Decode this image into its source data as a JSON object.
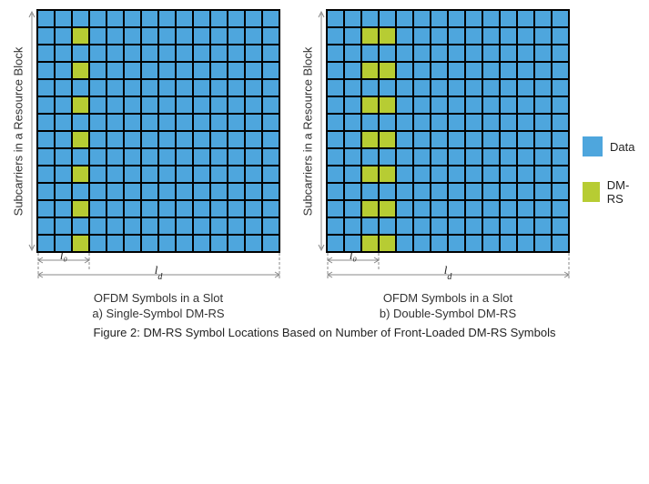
{
  "figure": {
    "caption": "Figure 2: DM-RS Symbol Locations Based on Number of Front-Loaded DM-RS Symbols",
    "yAxisLabel": "Subcarriers in a Resource Block",
    "xAxisLabel": "OFDM Symbols in a Slot",
    "l0Label": "l₀",
    "ldLabel": "l_d",
    "legend": {
      "data": "Data",
      "dmrs": "DM-RS"
    }
  },
  "colors": {
    "data": "#4ea6dd",
    "dmrs": "#b7cc33"
  },
  "panelA": {
    "subcaption": "a) Single-Symbol DM-RS"
  },
  "panelB": {
    "subcaption": "b) Double-Symbol DM-RS"
  },
  "chart_data": [
    {
      "type": "heatmap",
      "name": "Single-Symbol DM-RS",
      "rows": 14,
      "cols": 14,
      "cell_size_px": 19,
      "ylabel": "Subcarriers in a Resource Block",
      "xlabel": "OFDM Symbols in a Slot",
      "annotations": {
        "l0_cols": [
          0,
          1,
          2
        ],
        "ld_cols": [
          0,
          1,
          2,
          3,
          4,
          5,
          6,
          7,
          8,
          9,
          10,
          11,
          12,
          13
        ]
      },
      "dmrs_cells": [
        {
          "row": 1,
          "col": 2
        },
        {
          "row": 3,
          "col": 2
        },
        {
          "row": 5,
          "col": 2
        },
        {
          "row": 7,
          "col": 2
        },
        {
          "row": 9,
          "col": 2
        },
        {
          "row": 11,
          "col": 2
        },
        {
          "row": 13,
          "col": 2
        }
      ],
      "default_cell": "data"
    },
    {
      "type": "heatmap",
      "name": "Double-Symbol DM-RS",
      "rows": 14,
      "cols": 14,
      "cell_size_px": 19,
      "ylabel": "Subcarriers in a Resource Block",
      "xlabel": "OFDM Symbols in a Slot",
      "annotations": {
        "l0_cols": [
          0,
          1,
          2
        ],
        "ld_cols": [
          0,
          1,
          2,
          3,
          4,
          5,
          6,
          7,
          8,
          9,
          10,
          11,
          12,
          13
        ]
      },
      "dmrs_cells": [
        {
          "row": 1,
          "col": 2
        },
        {
          "row": 1,
          "col": 3
        },
        {
          "row": 3,
          "col": 2
        },
        {
          "row": 3,
          "col": 3
        },
        {
          "row": 5,
          "col": 2
        },
        {
          "row": 5,
          "col": 3
        },
        {
          "row": 7,
          "col": 2
        },
        {
          "row": 7,
          "col": 3
        },
        {
          "row": 9,
          "col": 2
        },
        {
          "row": 9,
          "col": 3
        },
        {
          "row": 11,
          "col": 2
        },
        {
          "row": 11,
          "col": 3
        },
        {
          "row": 13,
          "col": 2
        },
        {
          "row": 13,
          "col": 3
        }
      ],
      "default_cell": "data"
    }
  ]
}
